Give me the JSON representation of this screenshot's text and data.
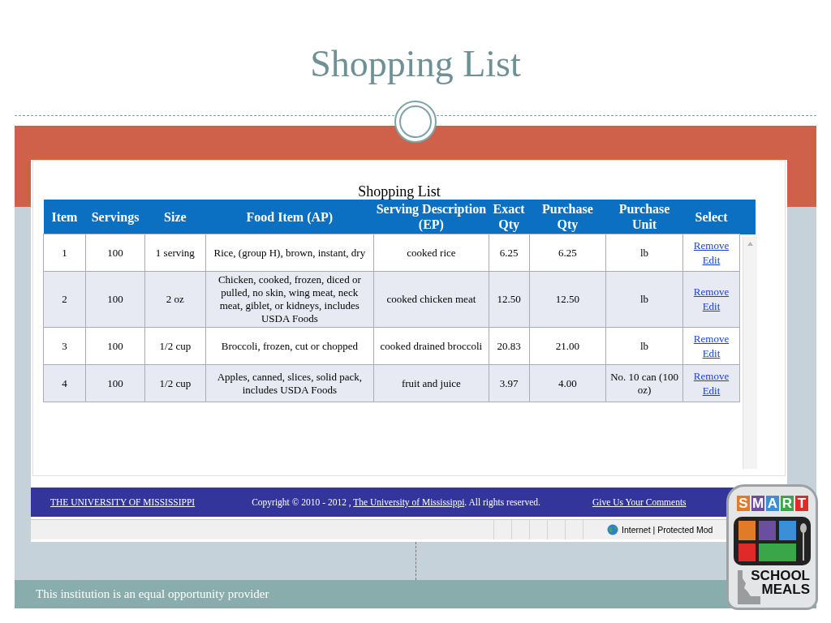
{
  "slide": {
    "title": "Shopping List",
    "footer": "This institution is an equal opportunity provider"
  },
  "page": {
    "caption": "Shopping List",
    "table": {
      "columns": [
        "Item",
        "Servings",
        "Size",
        "Food Item (AP)",
        "Serving Description (EP)",
        "Exact Qty",
        "Purchase Qty",
        "Purchase Unit",
        "Select"
      ],
      "rows": [
        {
          "cells": [
            "1",
            "100",
            "1 serving",
            "Rice, (group H), brown, instant, dry",
            "cooked rice",
            "6.25",
            "6.25",
            "lb"
          ],
          "actions": [
            "Remove",
            "Edit"
          ]
        },
        {
          "cells": [
            "2",
            "100",
            "2 oz",
            "Chicken, cooked, frozen, diced or pulled, no skin, wing meat, neck meat, giblet, or kidneys, includes USDA Foods",
            "cooked chicken meat",
            "12.50",
            "12.50",
            "lb"
          ],
          "actions": [
            "Remove",
            "Edit"
          ]
        },
        {
          "cells": [
            "3",
            "100",
            "1/2 cup",
            "Broccoli, frozen, cut or chopped",
            "cooked drained broccoli",
            "20.83",
            "21.00",
            "lb"
          ],
          "actions": [
            "Remove",
            "Edit"
          ]
        },
        {
          "cells": [
            "4",
            "100",
            "1/2 cup",
            "Apples, canned, slices, solid pack, includes USDA Foods",
            "fruit and juice",
            "3.97",
            "4.00",
            "No. 10 can (100 oz)"
          ],
          "actions": [
            "Remove",
            "Edit"
          ]
        }
      ]
    },
    "footer": {
      "left_link": "THE UNIVERSITY OF MISSISSIPPI",
      "copyright_start": "Copyright © 2010 - 2012 , ",
      "copyright_link": "The University of Mississippi",
      "copyright_end": ". All rights reserved.",
      "comments_link": "Give Us Your Comments"
    },
    "status_bar": {
      "zone": "Internet | Protected Mod"
    }
  },
  "logo": {
    "letters": [
      {
        "text": "S",
        "color": "#e07b2a"
      },
      {
        "text": "M",
        "color": "#6c4ea0"
      },
      {
        "text": "A",
        "color": "#3b8fd6"
      },
      {
        "text": "R",
        "color": "#3aa64a"
      },
      {
        "text": "T",
        "color": "#e02a2a"
      }
    ],
    "lines": [
      "SCHOOL",
      "MEALS"
    ]
  }
}
